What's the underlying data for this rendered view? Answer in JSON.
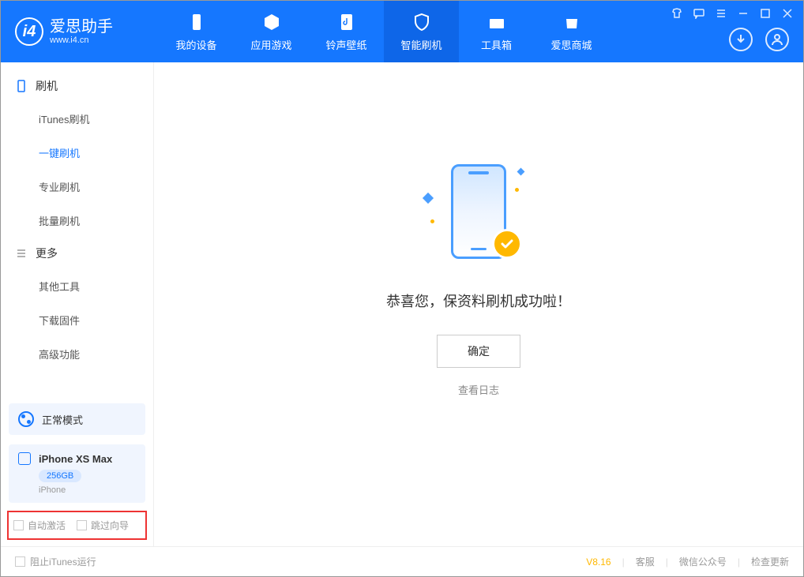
{
  "app": {
    "name": "爱思助手",
    "url": "www.i4.cn"
  },
  "nav": {
    "items": [
      {
        "label": "我的设备"
      },
      {
        "label": "应用游戏"
      },
      {
        "label": "铃声壁纸"
      },
      {
        "label": "智能刷机"
      },
      {
        "label": "工具箱"
      },
      {
        "label": "爱思商城"
      }
    ]
  },
  "sidebar": {
    "group1": "刷机",
    "items1": [
      "iTunes刷机",
      "一键刷机",
      "专业刷机",
      "批量刷机"
    ],
    "group2": "更多",
    "items2": [
      "其他工具",
      "下载固件",
      "高级功能"
    ]
  },
  "mode": {
    "label": "正常模式"
  },
  "device": {
    "name": "iPhone XS Max",
    "storage": "256GB",
    "type": "iPhone"
  },
  "options": {
    "auto_activate": "自动激活",
    "skip_guide": "跳过向导"
  },
  "main": {
    "success": "恭喜您，保资料刷机成功啦！",
    "ok_btn": "确定",
    "view_log": "查看日志"
  },
  "footer": {
    "block_itunes": "阻止iTunes运行",
    "version": "V8.16",
    "support": "客服",
    "wechat": "微信公众号",
    "update": "检查更新"
  }
}
